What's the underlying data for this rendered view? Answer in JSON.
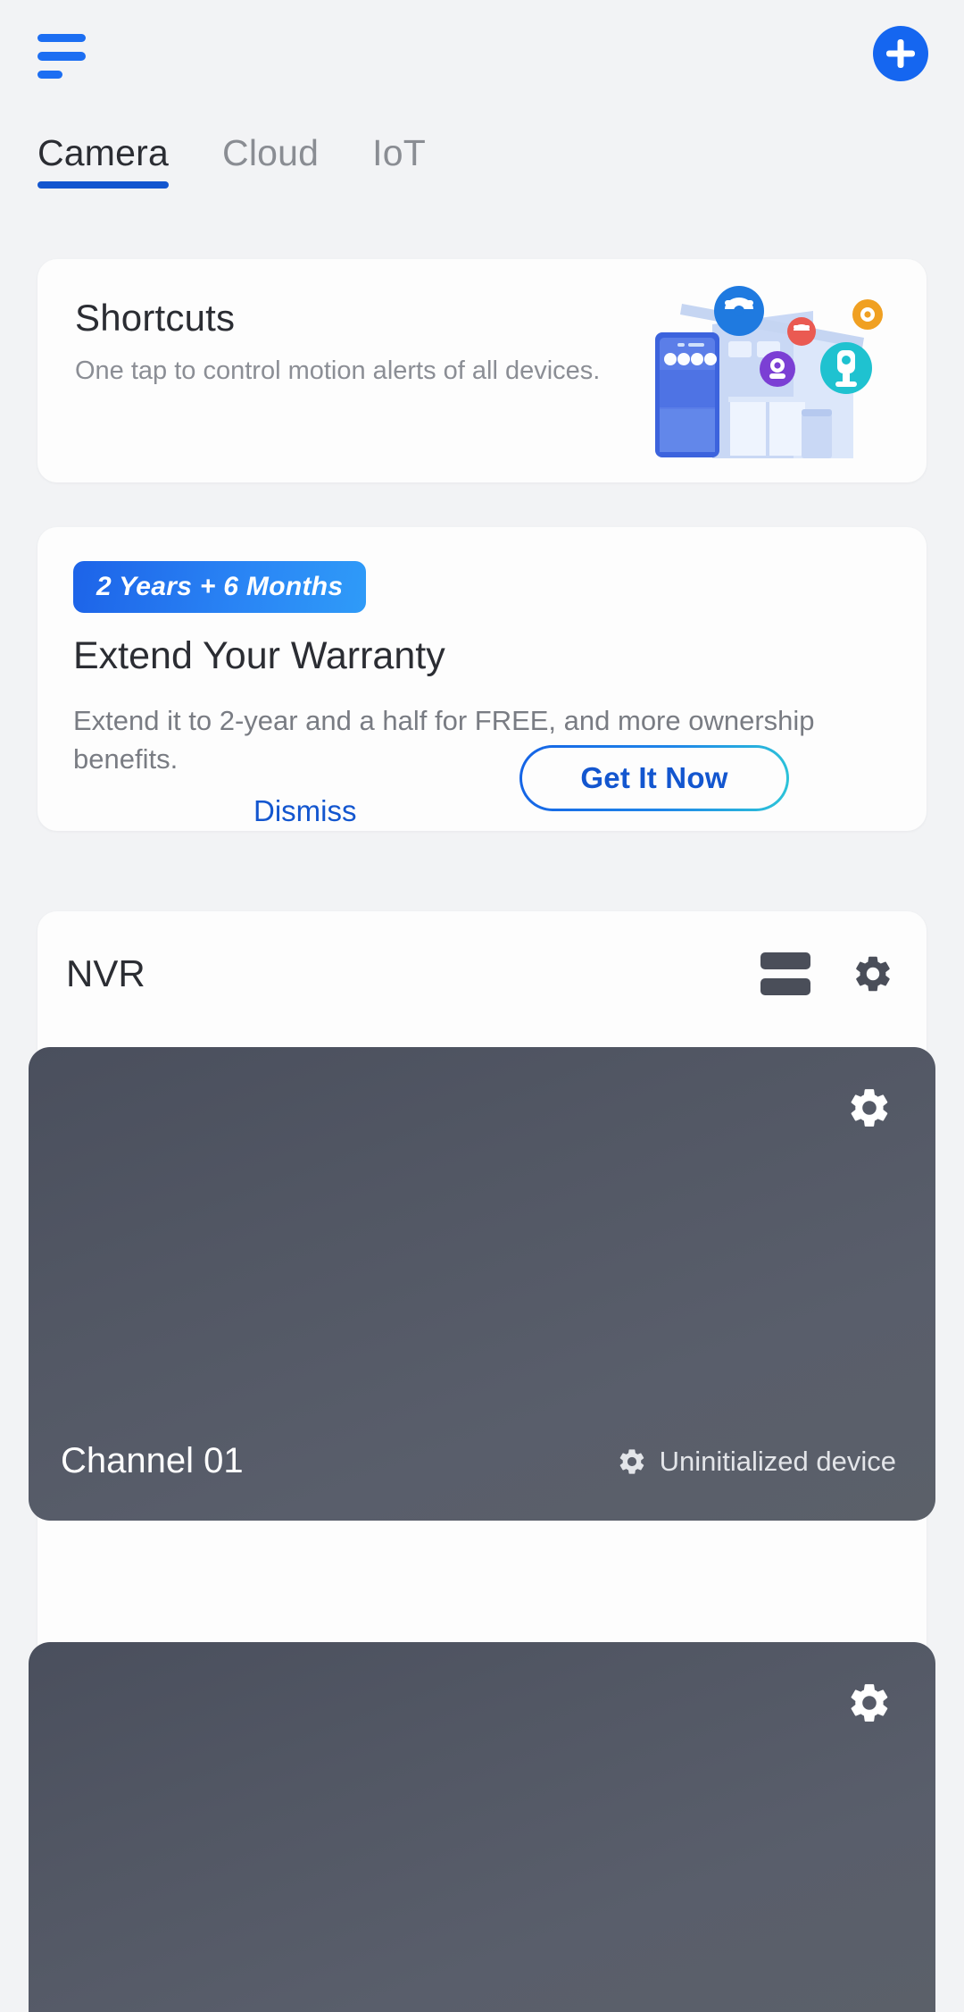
{
  "app": {
    "menu_icon": "hamburger-icon",
    "add_icon": "plus-icon",
    "accent_blue": "#1566f0",
    "background": "#f2f3f5"
  },
  "tabs": [
    {
      "label": "Camera",
      "active": true
    },
    {
      "label": "Cloud",
      "active": false
    },
    {
      "label": "IoT",
      "active": false
    }
  ],
  "shortcuts": {
    "title": "Shortcuts",
    "subtitle": "One tap to control motion alerts of all devices.",
    "illustration": "smart-home-cameras-illustration"
  },
  "warranty": {
    "badge": "2 Years + 6 Months",
    "title": "Extend Your Warranty",
    "description": "Extend it to 2-year and a half for FREE, and more ownership benefits.",
    "dismiss_label": "Dismiss",
    "cta_label": "Get It Now",
    "badge_gradient_from": "#1d63e8",
    "badge_gradient_to": "#2f9bf8",
    "cta_gradient_from": "#1463e6",
    "cta_gradient_to": "#2cc5d8",
    "link_color": "#1356cf"
  },
  "nvr": {
    "title": "NVR",
    "layout_icon": "list-view-icon",
    "settings_icon": "gear-icon",
    "channels": [
      {
        "name": "Channel 01",
        "status": "Uninitialized device",
        "status_icon": "gear-icon",
        "settings_icon": "gear-icon"
      },
      {
        "name": "",
        "status": "",
        "status_icon": "gear-icon",
        "settings_icon": "gear-icon"
      }
    ]
  }
}
